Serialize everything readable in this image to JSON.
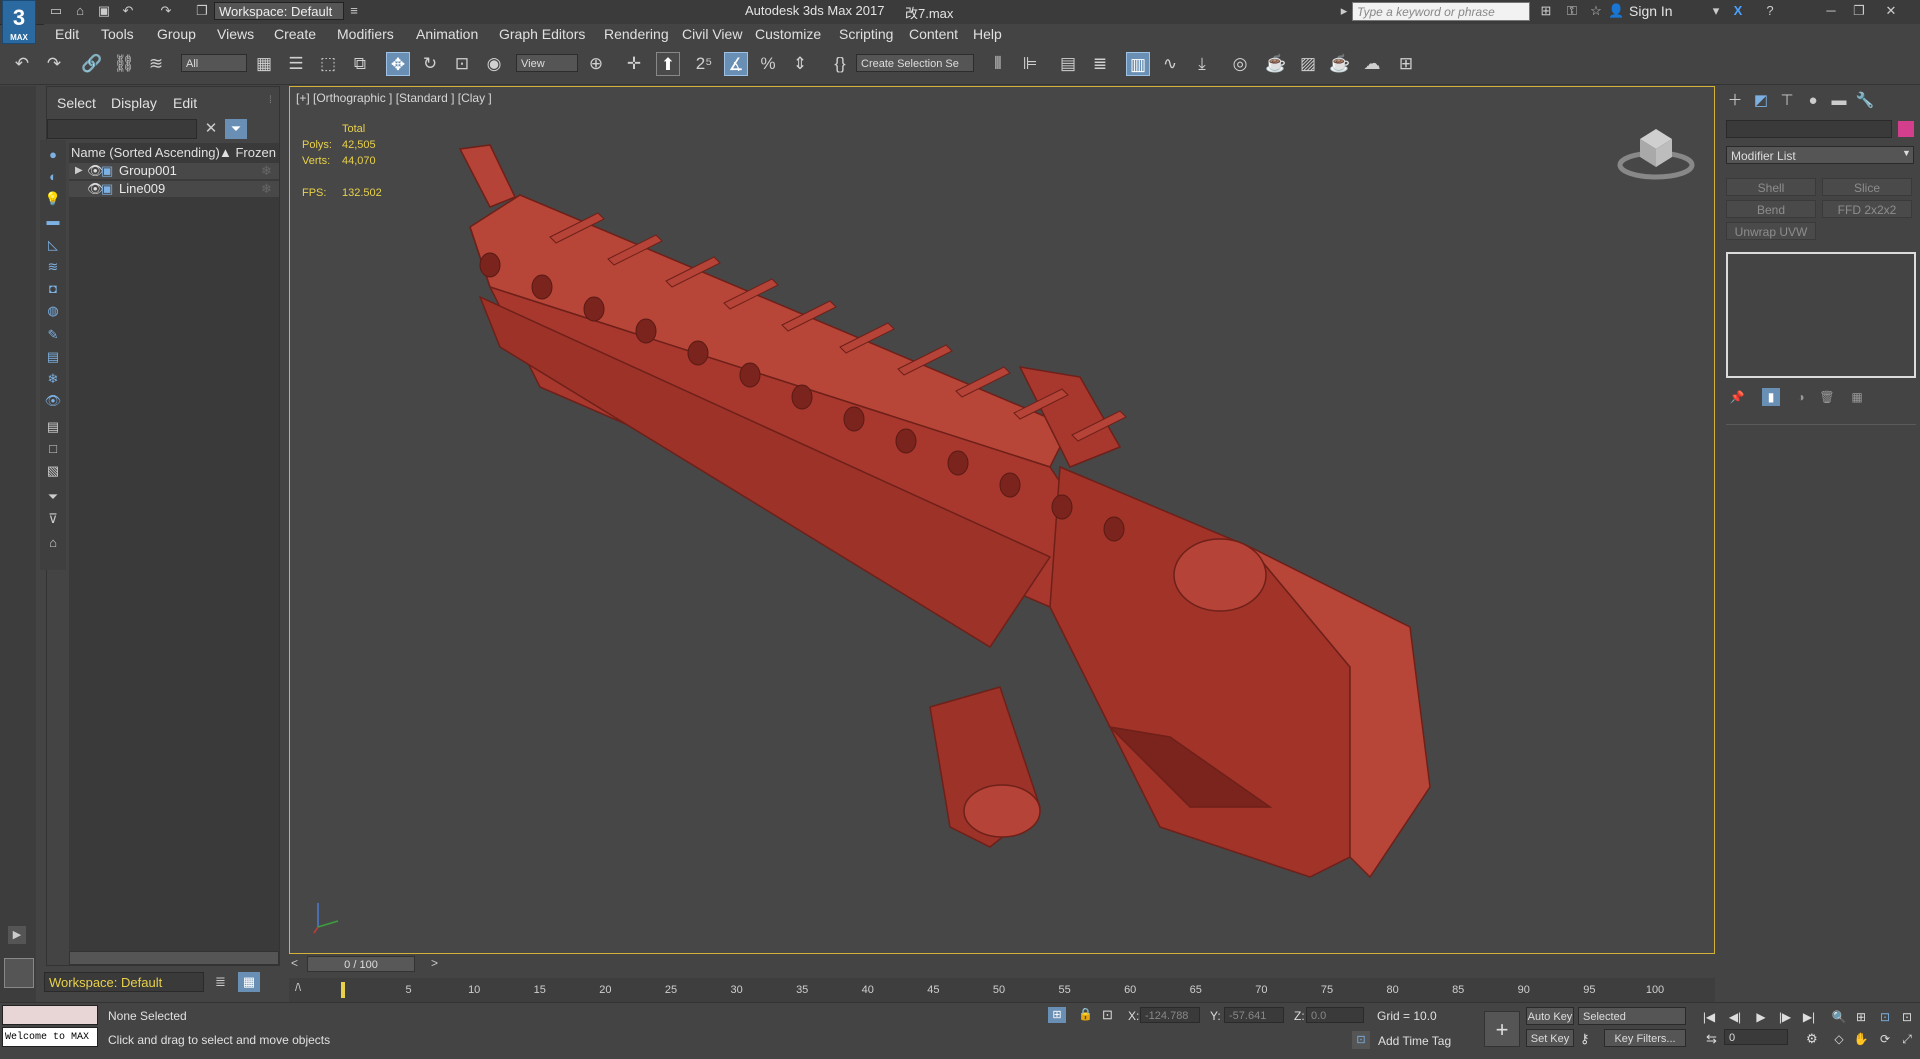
{
  "titlebar": {
    "logo": "3",
    "logo_sub": "MAX",
    "workspace": "Workspace: Default",
    "app_title": "Autodesk 3ds Max 2017",
    "file_name": "改7.max",
    "search_placeholder": "Type a keyword or phrase",
    "sign_in": "Sign In"
  },
  "menu": [
    "Edit",
    "Tools",
    "Group",
    "Views",
    "Create",
    "Modifiers",
    "Animation",
    "Graph Editors",
    "Rendering",
    "Civil View",
    "Customize",
    "Scripting",
    "Content",
    "Help"
  ],
  "toolbar": {
    "filter": "All",
    "ref_coord": "View",
    "selection_set": "Create Selection Se"
  },
  "explorer": {
    "tabs": [
      "Select",
      "Display",
      "Edit"
    ],
    "col_name": "Name (Sorted Ascending)",
    "col_frozen": "▲ Frozen",
    "rows": [
      {
        "name": "Group001"
      },
      {
        "name": "Line009"
      }
    ],
    "workspace": "Workspace: Default"
  },
  "viewport": {
    "label": "[+] [Orthographic ] [Standard ] [Clay ]",
    "stats": {
      "total_label": "Total",
      "polys_label": "Polys:",
      "polys": "42,505",
      "verts_label": "Verts:",
      "verts": "44,070",
      "fps_label": "FPS:",
      "fps": "132.502"
    },
    "model_color": "#a8372e"
  },
  "command_panel": {
    "modifier_list": "Modifier List",
    "modifiers": [
      "Shell",
      "Slice",
      "Bend",
      "FFD 2x2x2",
      "Unwrap UVW"
    ],
    "object_color": "#d43f8d"
  },
  "timeline": {
    "position": "0 / 100",
    "ticks": [
      "5",
      "10",
      "15",
      "20",
      "25",
      "30",
      "35",
      "40",
      "45",
      "50",
      "55",
      "60",
      "65",
      "70",
      "75",
      "80",
      "85",
      "90",
      "95",
      "100"
    ]
  },
  "status": {
    "maxscript_hint": "Welcome to MAX",
    "selection": "None Selected",
    "prompt": "Click and drag to select and move objects",
    "x_label": "X:",
    "x_value": "-124.788",
    "y_label": "Y:",
    "y_value": "-57.641",
    "z_label": "Z:",
    "z_value": "0.0",
    "grid": "Grid = 10.0",
    "add_time_tag": "Add Time Tag",
    "auto_key": "Auto Key",
    "set_key": "Set Key",
    "selected": "Selected",
    "key_filters": "Key Filters...",
    "frame": "0"
  }
}
